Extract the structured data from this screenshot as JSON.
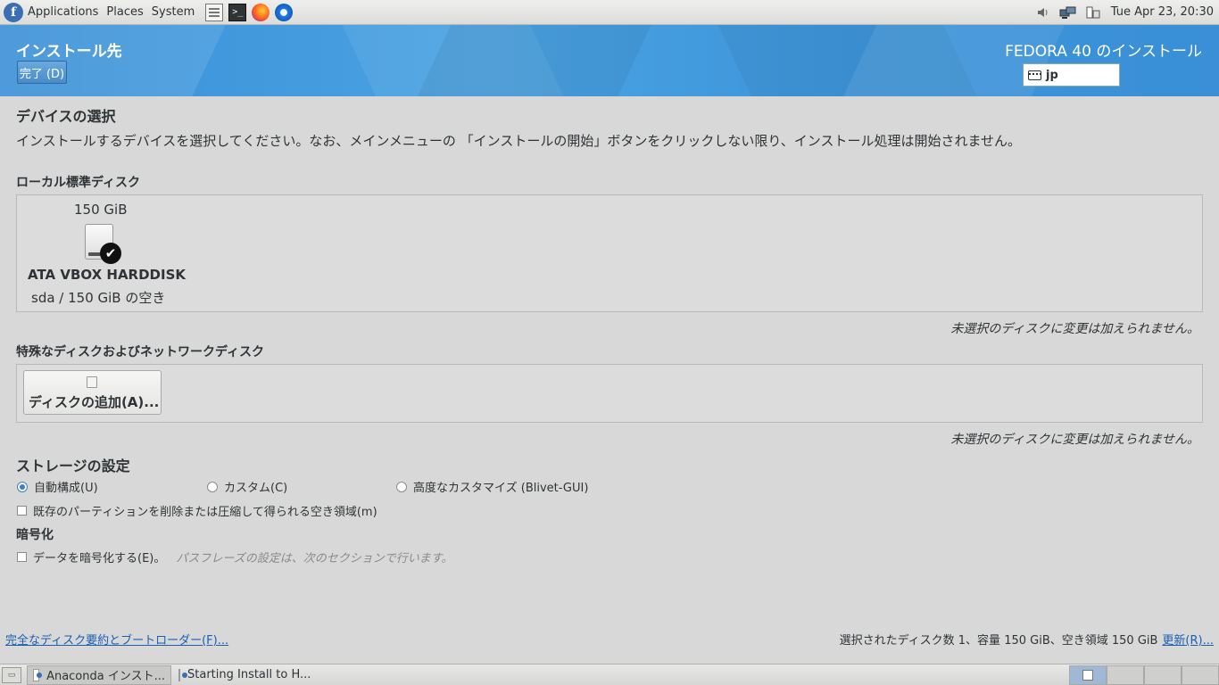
{
  "top_panel": {
    "logo": "f",
    "menus": [
      "Applications",
      "Places",
      "System"
    ],
    "launchers": [
      "notes-icon",
      "terminal-icon",
      "firefox-icon",
      "thunderbird-icon"
    ],
    "terminal_glyph": ">_",
    "tray": [
      "volume-icon",
      "network-icon",
      "power-icon"
    ],
    "clock": "Tue Apr 23, 20:30"
  },
  "header": {
    "title": "インストール先",
    "done_label": "完了 (D)",
    "product_title": "FEDORA 40 のインストール",
    "keyboard_layout": "jp",
    "colors": {
      "banner": "#3d95da",
      "text": "#ffffff"
    }
  },
  "device_selection": {
    "title": "デバイスの選択",
    "description": "インストールするデバイスを選択してください。なお、メインメニューの 「インストールの開始」ボタンをクリックしない限り、インストール処理は開始されません。",
    "local_disks_title": "ローカル標準ディスク",
    "disks": [
      {
        "size": "150 GiB",
        "name": "ATA VBOX HARDDISK",
        "info": "sda  /  150 GiB の空き",
        "selected": true
      }
    ],
    "local_note": "未選択のディスクに変更は加えられません。",
    "special_disks_title": "特殊なディスクおよびネットワークディスク",
    "add_disk_label": "ディスクの追加(A)...",
    "special_note": "未選択のディスクに変更は加えられません。"
  },
  "storage_config": {
    "title": "ストレージの設定",
    "options": [
      {
        "label": "自動構成(U)",
        "checked": true
      },
      {
        "label": "カスタム(C)",
        "checked": false
      },
      {
        "label": "高度なカスタマイズ (Blivet-GUI)",
        "checked": false
      }
    ],
    "reclaim_label": "既存のパーティションを削除または圧縮して得られる空き領域(m)",
    "reclaim_checked": false
  },
  "encryption": {
    "title": "暗号化",
    "encrypt_label": "データを暗号化する(E)。",
    "encrypt_hint": "パスフレーズの設定は、次のセクションで行います。",
    "encrypt_checked": false
  },
  "footer": {
    "summary_link": "完全なディスク要約とブートローダー(F)...",
    "summary": "選択されたディスク数 1、容量 150 GiB、空き領域 150 GiB",
    "refresh_link": "更新(R)..."
  },
  "taskbar": {
    "show_desktop_glyph": "▭",
    "tasks": [
      {
        "label": "Anaconda インスト...",
        "active": true
      },
      {
        "label": "Starting Install to H...",
        "active": false
      }
    ],
    "workspaces": 4,
    "active_workspace": 1
  }
}
